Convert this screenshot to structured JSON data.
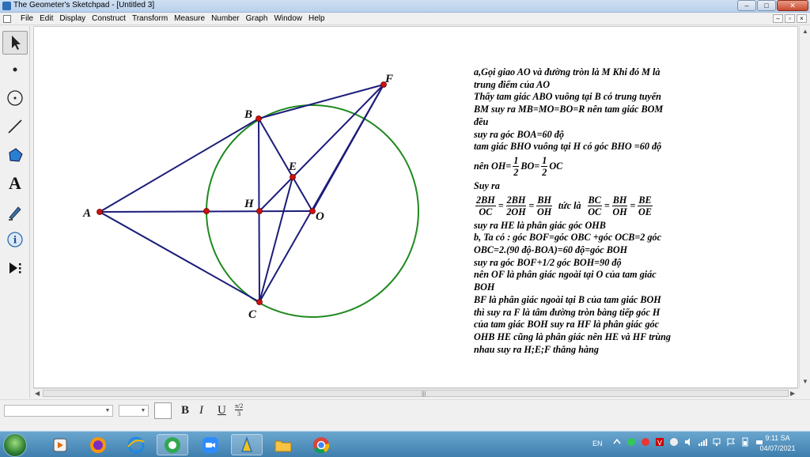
{
  "window": {
    "title": "The Geometer's Sketchpad - [Untitled 3]",
    "buttons": {
      "minimize": "–",
      "maximize": "□",
      "close": "✕"
    }
  },
  "menu": {
    "items": [
      "File",
      "Edit",
      "Display",
      "Construct",
      "Transform",
      "Measure",
      "Number",
      "Graph",
      "Window",
      "Help"
    ],
    "mdi_buttons": [
      "–",
      "▫",
      "×"
    ]
  },
  "toolbox": {
    "tools": [
      "arrow-select-tool",
      "point-tool",
      "compass-tool",
      "straightedge-tool",
      "polygon-tool",
      "text-tool",
      "marker-tool",
      "information-tool",
      "custom-tool"
    ]
  },
  "figure": {
    "point_labels": {
      "A": "A",
      "B": "B",
      "C": "C",
      "E": "E",
      "F": "F",
      "H": "H",
      "O": "O"
    },
    "circle_color": "#1f8a1f",
    "segment_color": "#1c1c7a",
    "point_color": "#cc1010"
  },
  "notes": {
    "l1": "a,Gọi giao AO và đường tròn là M Khi đó M là",
    "l2": "trung điểm của AO",
    "l3": " Thấy tam giác ABO vuông tại B có trung tuyến",
    "l4": "BM suy ra MB=MO=BO=R nên tam giác BOM",
    "l5": "đều",
    "l6": "suy ra góc BOA=60 độ",
    "l7": "tam giác BHO vuông tại H có góc BHO =60 độ",
    "l8_prefix": "nên OH=",
    "l8_frac1_num": "1",
    "l8_frac1_den": "2",
    "l8_mid": "BO=",
    "l8_frac2_num": "1",
    "l8_frac2_den": "2",
    "l8_suffix": "OC",
    "l9": "Suy ra",
    "f1_num": "2BH",
    "f1_den": "OC",
    "f2_num": "2BH",
    "f2_den": "2OH",
    "f3_num": "BH",
    "f3_den": "OH",
    "mid_text": "tức là",
    "f4_num": "BC",
    "f4_den": "OC",
    "f5_num": "BH",
    "f5_den": "OH",
    "f6_num": "BE",
    "f6_den": "OE",
    "eq": "=",
    "l10": "suy ra HE là phân giác góc OHB",
    "l11": "b, Ta có : góc BOF=góc OBC +góc OCB=2 góc",
    "l12": "OBC=2.(90 độ-BOA)=60 độ=góc BOH",
    "l13": "suy ra góc BOF+1/2 góc BOH=90 độ",
    "l14": "nên OF là phân giác ngoài tại O của tam giác",
    "l15": "BOH",
    "l16": "BF là phân giác ngoài tại B của tam giác BOH",
    "l17": "thì suy ra F là tâm đường tròn bàng tiếp góc H",
    "l18": "của tam giác BOH suy ra HF là phân giác góc",
    "l19": "OHB HE cũng là phân giác nên HE và HF trùng",
    "l20": "nhau suy ra H;E;F thẳng hàng"
  },
  "textbar": {
    "bold": "B",
    "italic": "I",
    "underline": "U",
    "symbol_num": "π/2",
    "symbol_den": "3"
  },
  "taskbar": {
    "language": "EN",
    "time": "9:11 SA",
    "date": "04/07/2021",
    "apps": [
      "explorer-app",
      "media-player-app",
      "firefox-app",
      "internet-explorer-app",
      "green-app",
      "zoom-app",
      "sketchpad-app",
      "folder-app",
      "chrome-app"
    ]
  }
}
